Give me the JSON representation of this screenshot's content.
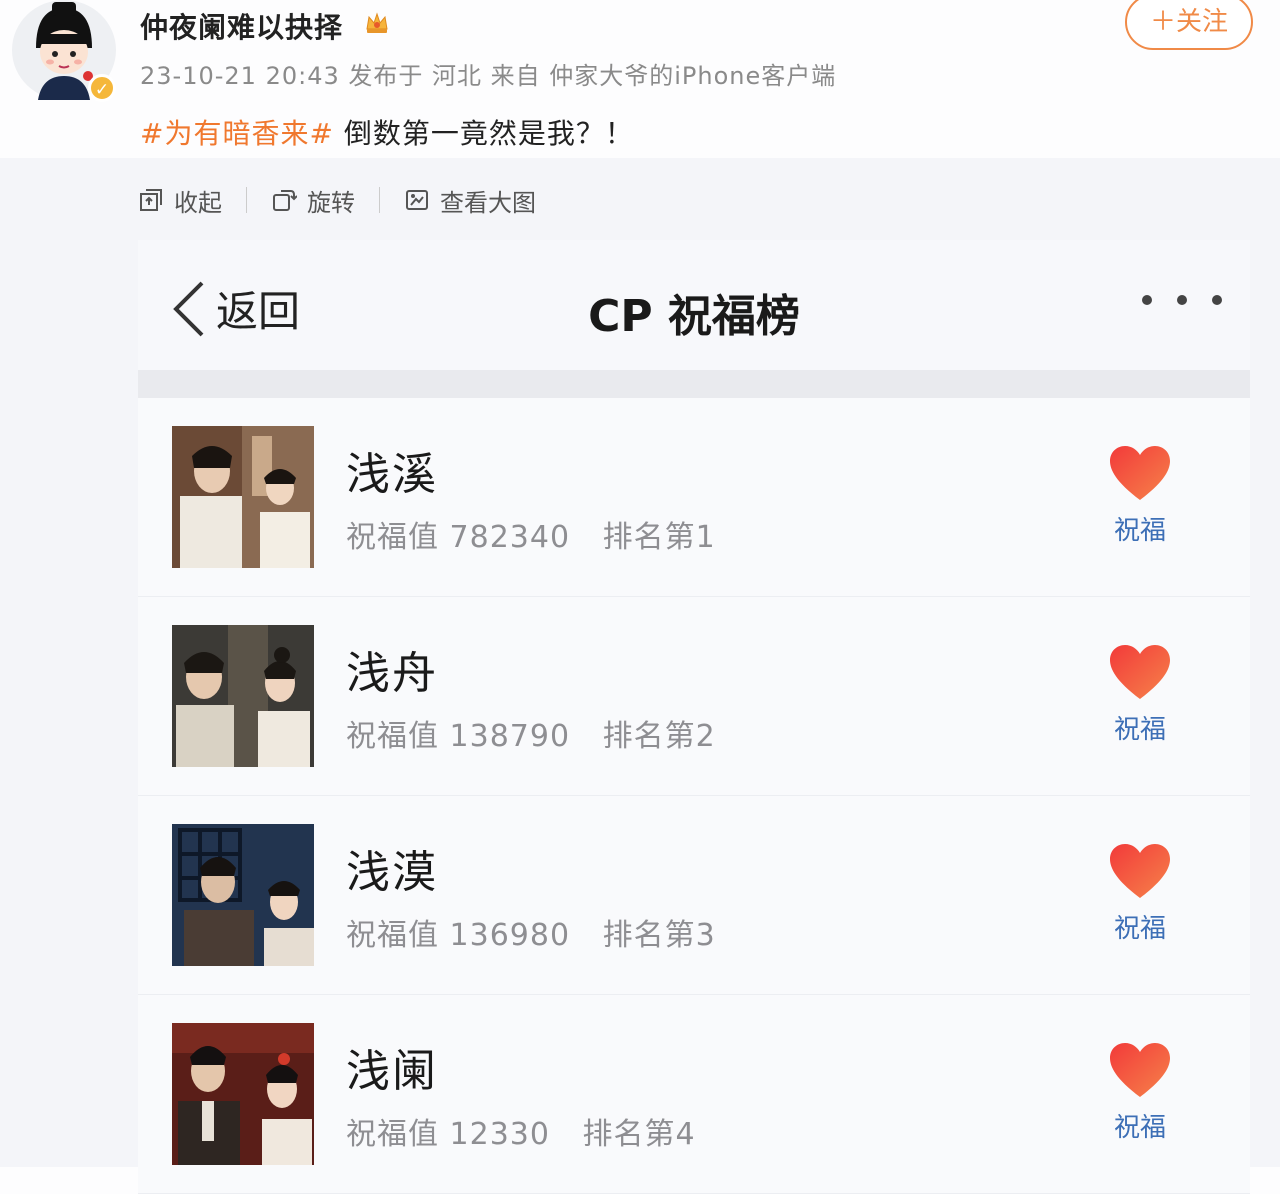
{
  "post": {
    "username": "仲夜阑难以抉择",
    "meta": "23-10-21 20:43 发布于 河北 来自 仲家大爷的iPhone客户端",
    "follow_label": "＋关注",
    "hashtag": "#为有暗香来#",
    "text": " 倒数第一竟然是我？！",
    "verified_icon": "verified-badge-icon",
    "crown_icon": "crown-icon"
  },
  "toolbar": {
    "collapse_label": "收起",
    "rotate_label": "旋转",
    "view_large_label": "查看大图"
  },
  "screenshot": {
    "back_label": "返回",
    "title": "CP 祝福榜",
    "items": [
      {
        "name": "浅溪",
        "value_label": "祝福值",
        "value": "782340",
        "rank_label": "排名第",
        "rank": "1",
        "button_label": "祝福"
      },
      {
        "name": "浅舟",
        "value_label": "祝福值",
        "value": "138790",
        "rank_label": "排名第",
        "rank": "2",
        "button_label": "祝福"
      },
      {
        "name": "浅漠",
        "value_label": "祝福值",
        "value": "136980",
        "rank_label": "排名第",
        "rank": "3",
        "button_label": "祝福"
      },
      {
        "name": "浅阑",
        "value_label": "祝福值",
        "value": "12330",
        "rank_label": "排名第",
        "rank": "4",
        "button_label": "祝福"
      }
    ]
  },
  "colors": {
    "accent_orange": "#f08a47",
    "hashtag": "#f0782e",
    "bless_blue": "#3d6fb6",
    "heart_red": "#f0453a"
  }
}
